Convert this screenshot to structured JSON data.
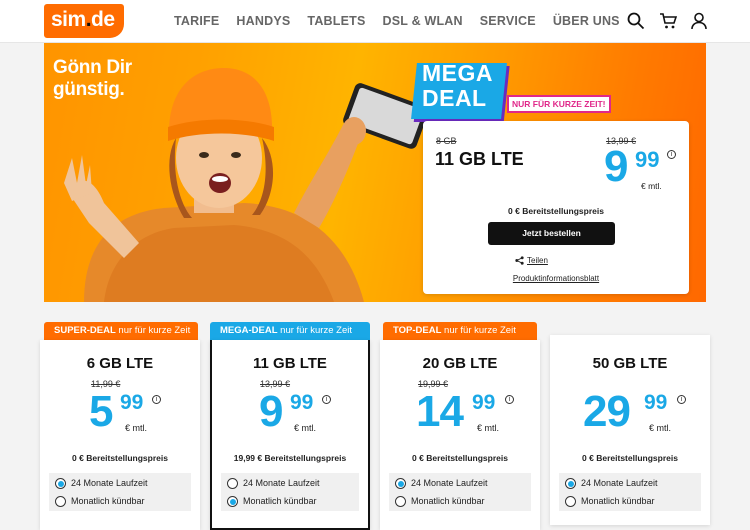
{
  "brand": {
    "logo_main": "sim",
    "logo_dot": ".",
    "logo_tld": "de",
    "accent": "#ff6c00",
    "price_color": "#1aa8e6"
  },
  "nav": {
    "items": [
      "TARIFE",
      "HANDYS",
      "TABLETS",
      "DSL & WLAN",
      "SERVICE",
      "ÜBER UNS"
    ]
  },
  "header_icons": [
    "search-icon",
    "cart-icon",
    "user-icon"
  ],
  "hero": {
    "slogan": "Gönn Dir\ngünstig.",
    "badge_text": "MEGA\nDEAL",
    "badge_sub": "NUR FÜR KURZE ZEIT!",
    "offer": {
      "old_gb": "8 GB",
      "gb": "11 GB LTE",
      "old_price": "13,99 €",
      "price_int": "9",
      "price_dec": "99",
      "info": "i",
      "unit": "€ mtl.",
      "setup": "0 € Bereitstellungspreis",
      "cta": "Jetzt bestellen",
      "share": "Teilen",
      "pib": "Produktinformationsblatt"
    }
  },
  "tariffs": [
    {
      "tab_bold": "SUPER-DEAL",
      "tab_rest": " nur für kurze Zeit",
      "tab_color": "orange",
      "gb": "6 GB LTE",
      "old": "11,99 €",
      "int": "5",
      "dec": "99",
      "unit": "€ mtl.",
      "setup": "0 € Bereitstellungspreis",
      "opt1": "24 Monate Laufzeit",
      "opt2": "Monatlich kündbar",
      "selected": 1
    },
    {
      "tab_bold": "MEGA-DEAL",
      "tab_rest": " nur für kurze Zeit",
      "tab_color": "blue",
      "gb": "11 GB LTE",
      "old": "13,99 €",
      "int": "9",
      "dec": "99",
      "unit": "€ mtl.",
      "setup": "19,99 € Bereitstellungspreis",
      "opt1": "24 Monate Laufzeit",
      "opt2": "Monatlich kündbar",
      "selected": 2
    },
    {
      "tab_bold": "TOP-DEAL",
      "tab_rest": " nur für kurze Zeit",
      "tab_color": "orange",
      "gb": "20 GB LTE",
      "old": "19,99 €",
      "int": "14",
      "dec": "99",
      "unit": "€ mtl.",
      "setup": "0 € Bereitstellungspreis",
      "opt1": "24 Monate Laufzeit",
      "opt2": "Monatlich kündbar",
      "selected": 1
    },
    {
      "tab_bold": "",
      "tab_rest": "",
      "tab_color": "",
      "gb": "50 GB LTE",
      "old": "",
      "int": "29",
      "dec": "99",
      "unit": "€ mtl.",
      "setup": "0 € Bereitstellungspreis",
      "opt1": "24 Monate Laufzeit",
      "opt2": "Monatlich kündbar",
      "selected": 1
    }
  ]
}
